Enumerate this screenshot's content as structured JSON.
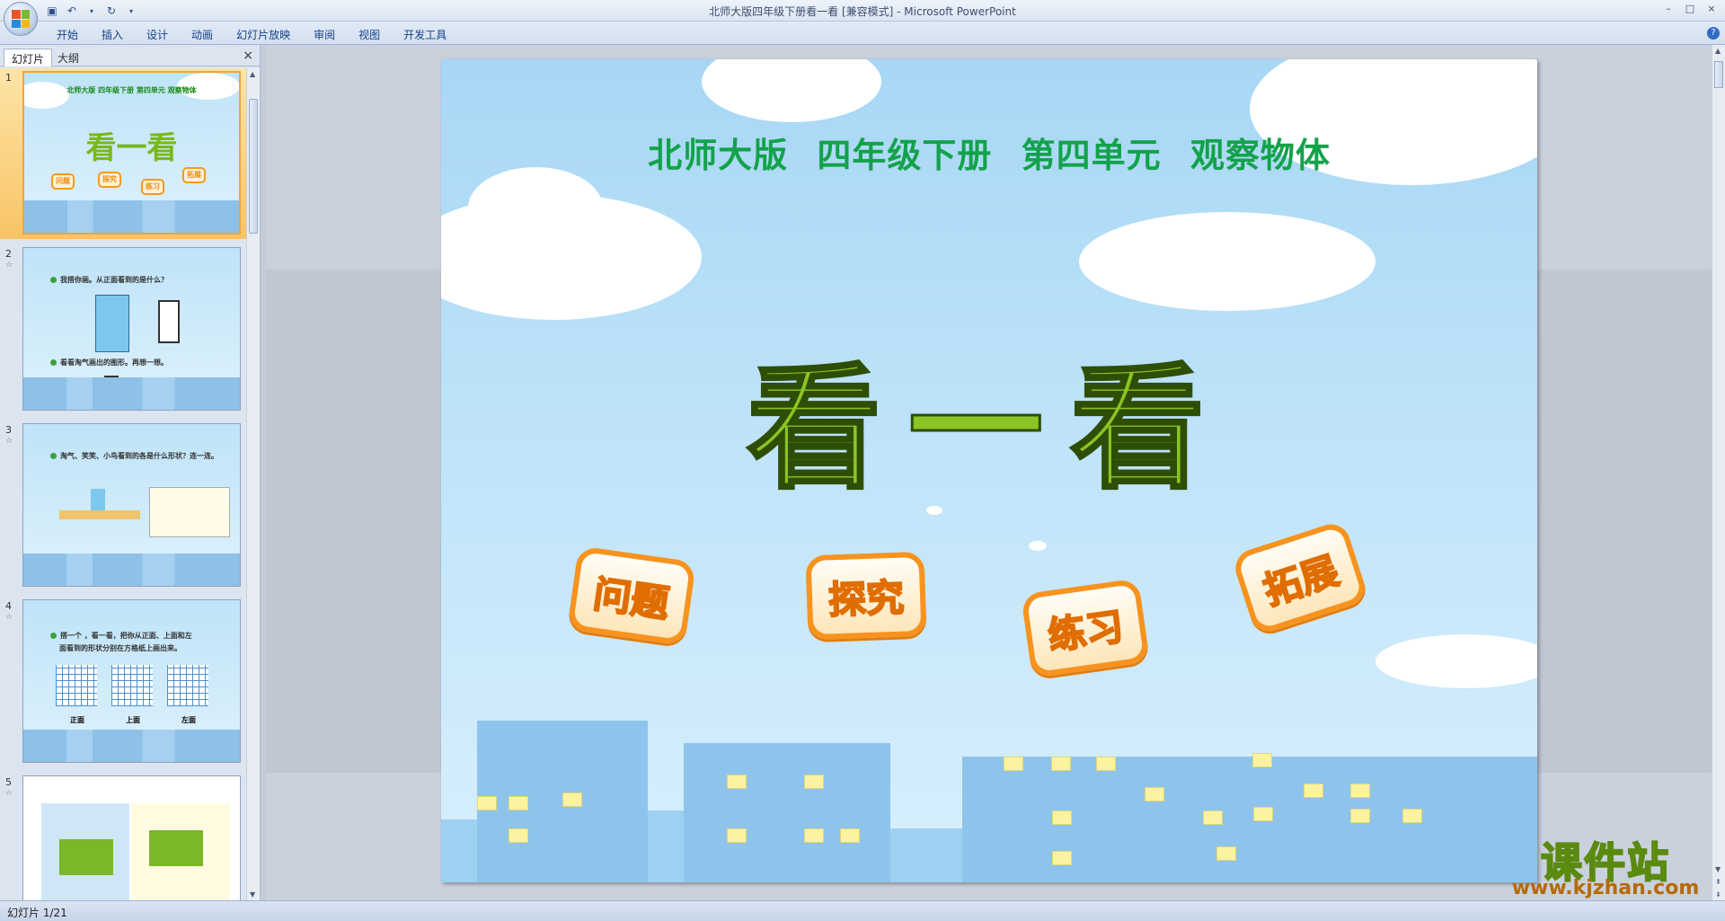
{
  "window": {
    "title": "北师大版四年级下册看一看 [兼容模式] - Microsoft PowerPoint",
    "controls": [
      "–",
      "□",
      "×"
    ]
  },
  "quick_access": {
    "save_icon": "save-icon",
    "undo_icon": "undo-icon",
    "redo_icon": "redo-icon"
  },
  "ribbon": {
    "tabs": [
      {
        "label": "开始"
      },
      {
        "label": "插入"
      },
      {
        "label": "设计"
      },
      {
        "label": "动画"
      },
      {
        "label": "幻灯片放映"
      },
      {
        "label": "审阅"
      },
      {
        "label": "视图"
      },
      {
        "label": "开发工具"
      }
    ],
    "help": "?"
  },
  "panel": {
    "tabs": [
      {
        "label": "幻灯片"
      },
      {
        "label": "大纲"
      }
    ],
    "close": "×",
    "thumbnails": [
      {
        "num": "1",
        "header": "北师大版  四年级下册  第四单元  观察物体",
        "title": "看一看",
        "badges": [
          "问题",
          "探究",
          "练习",
          "拓展"
        ],
        "selected": true
      },
      {
        "num": "2",
        "lines": [
          "我搭你画。从正面看到的是什么？",
          "看看淘气画出的图形。再想一想。"
        ]
      },
      {
        "num": "3",
        "lines": [
          "淘气、笑笑、小鸟看到的各是什么形状？连一连。"
        ]
      },
      {
        "num": "4",
        "lines": [
          "搭一个 ，看一看，把你从正面、上面和左",
          "面看到的形状分别在方格纸上画出来。"
        ],
        "labels": [
          "正面",
          "上面",
          "左面"
        ]
      },
      {
        "num": "5"
      }
    ]
  },
  "slide": {
    "header": "北师大版  四年级下册  第四单元  观察物体",
    "title": "看一看",
    "buttons": [
      {
        "label": "问题"
      },
      {
        "label": "探究"
      },
      {
        "label": "练习"
      },
      {
        "label": "拓展"
      }
    ],
    "colors": {
      "header": "#13a24a",
      "title": "#8cc424",
      "button": "#f7931e",
      "sky": "#a7d7f5"
    }
  },
  "watermark": {
    "title": "课件站",
    "url": "www.kjzhan.com"
  },
  "status": {
    "slide_counter": "幻灯片 1/21"
  }
}
